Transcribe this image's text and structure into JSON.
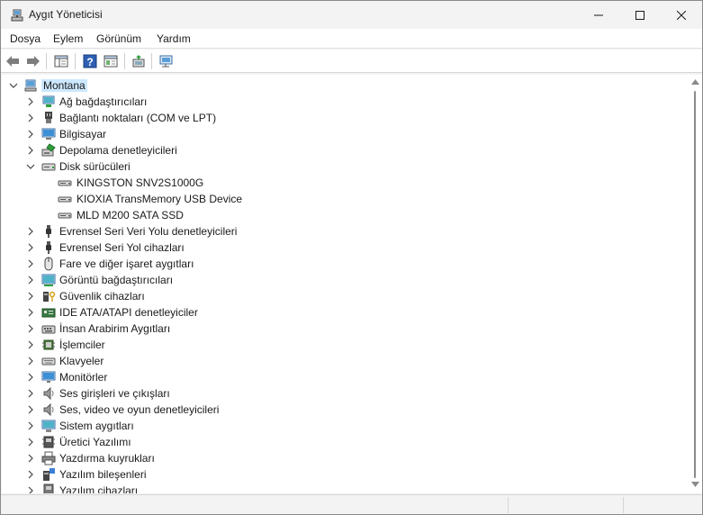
{
  "window": {
    "title": "Aygıt Yöneticisi"
  },
  "menu": [
    "Dosya",
    "Eylem",
    "Görünüm",
    "Yardım"
  ],
  "toolbar": {
    "buttons": [
      "back-arrow-icon",
      "forward-arrow-icon",
      "show-hide-console-tree-icon",
      "help-icon",
      "properties-icon",
      "update-driver-icon",
      "scan-hardware-icon"
    ]
  },
  "tree": {
    "root": "Montana",
    "categories": [
      {
        "label": "Ağ bağdaştırıcıları",
        "icon": "network-adapter-icon",
        "expanded": false
      },
      {
        "label": "Bağlantı noktaları (COM ve LPT)",
        "icon": "port-icon",
        "expanded": false
      },
      {
        "label": "Bilgisayar",
        "icon": "computer-icon",
        "expanded": false
      },
      {
        "label": "Depolama denetleyicileri",
        "icon": "storage-controller-icon",
        "expanded": false
      },
      {
        "label": "Disk sürücüleri",
        "icon": "disk-drive-icon",
        "expanded": true,
        "children": [
          "KINGSTON SNV2S1000G",
          "KIOXIA TransMemory USB Device",
          "MLD M200 SATA SSD"
        ]
      },
      {
        "label": "Evrensel Seri Veri Yolu denetleyicileri",
        "icon": "usb-icon",
        "expanded": false
      },
      {
        "label": "Evrensel Seri Yol cihazları",
        "icon": "usb-icon",
        "expanded": false
      },
      {
        "label": "Fare ve diğer işaret aygıtları",
        "icon": "mouse-icon",
        "expanded": false
      },
      {
        "label": "Görüntü bağdaştırıcıları",
        "icon": "display-adapter-icon",
        "expanded": false
      },
      {
        "label": "Güvenlik cihazları",
        "icon": "security-device-icon",
        "expanded": false
      },
      {
        "label": "IDE ATA/ATAPI denetleyiciler",
        "icon": "ide-controller-icon",
        "expanded": false
      },
      {
        "label": "İnsan Arabirim Aygıtları",
        "icon": "hid-icon",
        "expanded": false
      },
      {
        "label": "İşlemciler",
        "icon": "processor-icon",
        "expanded": false
      },
      {
        "label": "Klavyeler",
        "icon": "keyboard-icon",
        "expanded": false
      },
      {
        "label": "Monitörler",
        "icon": "monitor-icon",
        "expanded": false
      },
      {
        "label": "Ses girişleri ve çıkışları",
        "icon": "audio-icon",
        "expanded": false
      },
      {
        "label": "Ses, video ve oyun denetleyicileri",
        "icon": "audio-icon",
        "expanded": false
      },
      {
        "label": "Sistem aygıtları",
        "icon": "system-device-icon",
        "expanded": false
      },
      {
        "label": "Üretici Yazılımı",
        "icon": "firmware-icon",
        "expanded": false
      },
      {
        "label": "Yazdırma kuyrukları",
        "icon": "printer-icon",
        "expanded": false
      },
      {
        "label": "Yazılım bileşenleri",
        "icon": "software-component-icon",
        "expanded": false
      },
      {
        "label": "Yazılım cihazları",
        "icon": "software-device-icon",
        "expanded": false
      }
    ]
  }
}
